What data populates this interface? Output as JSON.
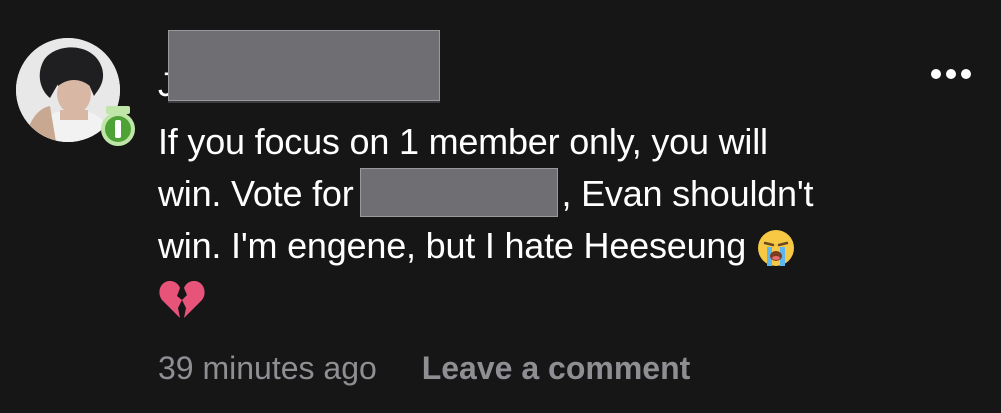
{
  "comment": {
    "author_name_visible": "J",
    "author_name_redacted": true,
    "body": {
      "line1": "If you focus on 1 member only, you will",
      "line2_before": "win. Vote for",
      "line2_after": ", Evan shouldn't",
      "line3": "win. I'm engene, but I hate Heeseung",
      "line3_emoji": "loudly-crying-face-emoji",
      "line4_emoji": "broken-heart-emoji"
    },
    "timestamp": "39 minutes ago",
    "leave_comment_label": "Leave a comment",
    "more_icon": "more-horizontal-icon",
    "avatar_badge_icon": "level-badge-icon"
  },
  "colors": {
    "background": "#161617",
    "text_primary": "#ffffff",
    "text_secondary": "#8e8e93",
    "redaction": "#6f6f73",
    "badge_green": "#4fa336"
  }
}
